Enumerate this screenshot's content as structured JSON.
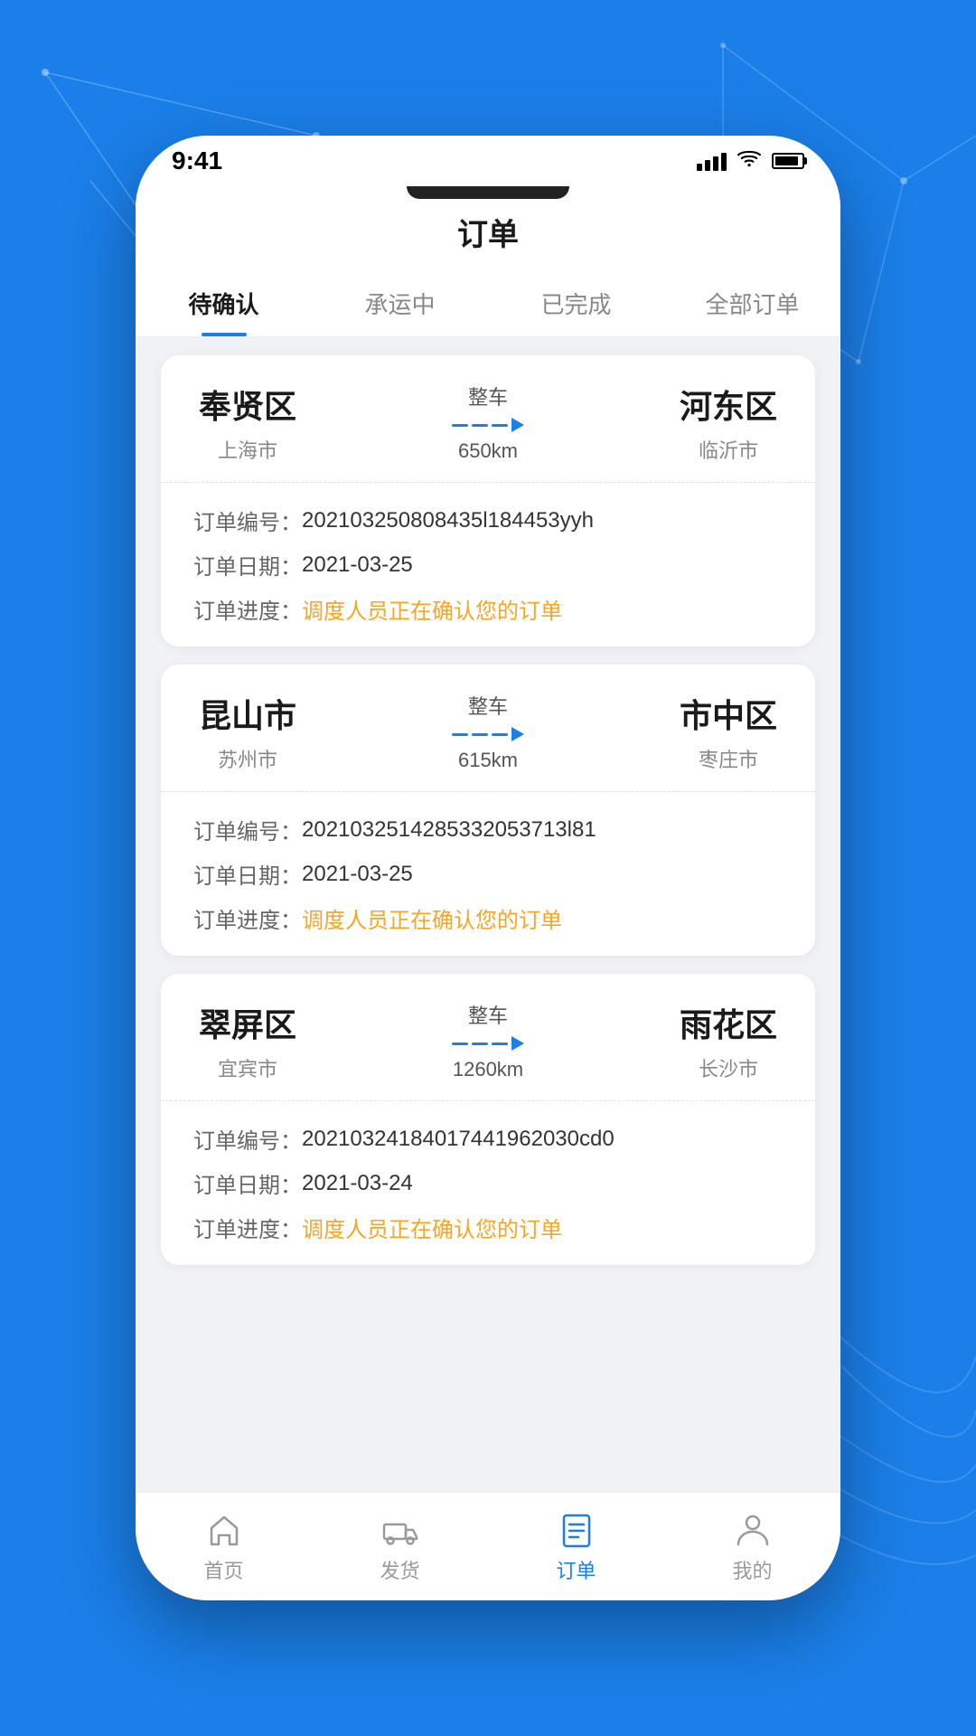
{
  "background": {
    "color": "#1a7fe8"
  },
  "status_bar": {
    "time": "9:41"
  },
  "header": {
    "title": "订单"
  },
  "tabs": [
    {
      "id": "pending",
      "label": "待确认",
      "active": true
    },
    {
      "id": "transporting",
      "label": "承运中",
      "active": false
    },
    {
      "id": "completed",
      "label": "已完成",
      "active": false
    },
    {
      "id": "all",
      "label": "全部订单",
      "active": false
    }
  ],
  "orders": [
    {
      "from_name": "奉贤区",
      "from_city": "上海市",
      "to_name": "河东区",
      "to_city": "临沂市",
      "type": "整车",
      "distance": "650km",
      "order_no_label": "订单编号：",
      "order_no": "202103250808435l184453yyh",
      "order_date_label": "订单日期：",
      "order_date": "2021-03-25",
      "order_progress_label": "订单进度：",
      "order_progress": "调度人员正在确认您的订单"
    },
    {
      "from_name": "昆山市",
      "from_city": "苏州市",
      "to_name": "市中区",
      "to_city": "枣庄市",
      "type": "整车",
      "distance": "615km",
      "order_no_label": "订单编号：",
      "order_no": "2021032514285332053713l81",
      "order_date_label": "订单日期：",
      "order_date": "2021-03-25",
      "order_progress_label": "订单进度：",
      "order_progress": "调度人员正在确认您的订单"
    },
    {
      "from_name": "翠屏区",
      "from_city": "宜宾市",
      "to_name": "雨花区",
      "to_city": "长沙市",
      "type": "整车",
      "distance": "1260km",
      "order_no_label": "订单编号：",
      "order_no": "20210324184017441962030cd0",
      "order_date_label": "订单日期：",
      "order_date": "2021-03-24",
      "order_progress_label": "订单进度：",
      "order_progress": "调度人员正在确认您的订单"
    }
  ],
  "bottom_nav": [
    {
      "id": "home",
      "label": "首页",
      "active": false
    },
    {
      "id": "ship",
      "label": "发货",
      "active": false
    },
    {
      "id": "order",
      "label": "订单",
      "active": true
    },
    {
      "id": "mine",
      "label": "我的",
      "active": false
    }
  ]
}
